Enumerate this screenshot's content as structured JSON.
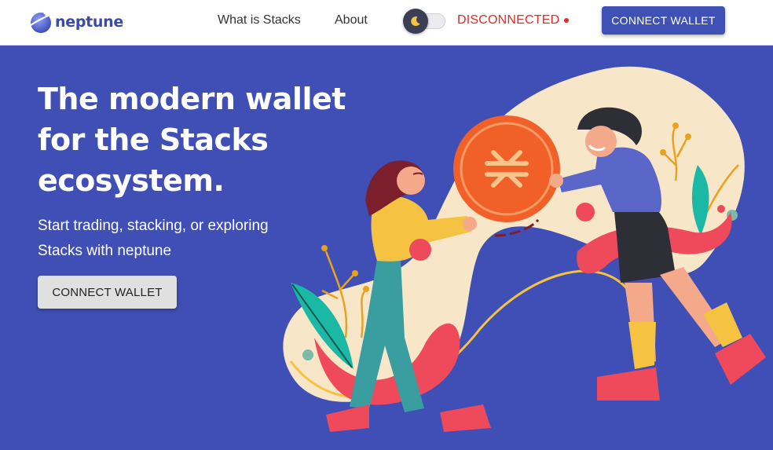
{
  "header": {
    "logo_text": "neptune",
    "nav": {
      "what_is_stacks": "What is Stacks",
      "about": "About"
    },
    "theme_toggle_icon": "moon-icon",
    "status_text": "DISCONNECTED",
    "connect_button": "CONNECT WALLET"
  },
  "hero": {
    "title": "The modern wallet for the Stacks ecosystem.",
    "subtitle": "Start trading, stacking, or exploring Stacks with neptune",
    "connect_button": "CONNECT WALLET"
  },
  "colors": {
    "brand": "#3f51b5",
    "hero_background": "#3f4fb5",
    "status_disconnected": "#e62828",
    "coin": "#f06028"
  }
}
